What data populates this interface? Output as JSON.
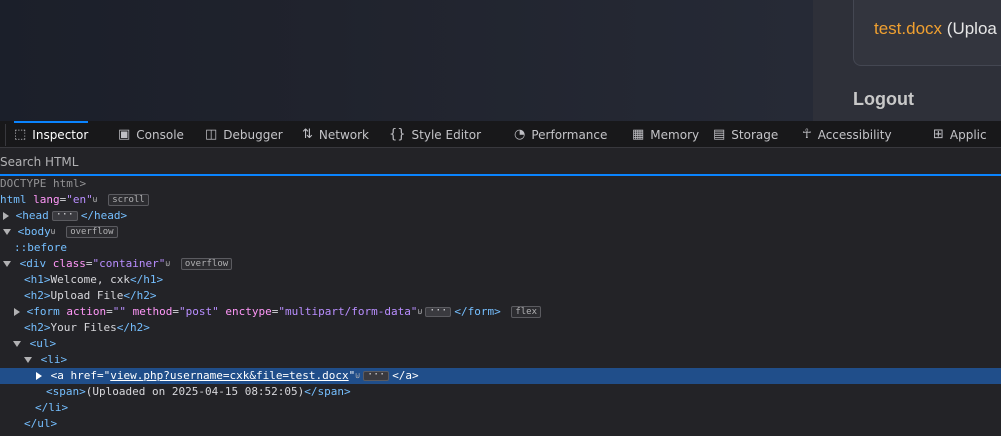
{
  "page": {
    "file_link": "test.docx",
    "file_meta": "(Uploa",
    "logout": "Logout"
  },
  "devtools": {
    "tabs": [
      {
        "label": "Inspector",
        "icon": "inspector-icon"
      },
      {
        "label": "Console",
        "icon": "console-icon"
      },
      {
        "label": "Debugger",
        "icon": "debugger-icon"
      },
      {
        "label": "Network",
        "icon": "network-icon"
      },
      {
        "label": "Style Editor",
        "icon": "style-editor-icon"
      },
      {
        "label": "Performance",
        "icon": "performance-icon"
      },
      {
        "label": "Memory",
        "icon": "memory-icon"
      },
      {
        "label": "Storage",
        "icon": "storage-icon"
      },
      {
        "label": "Accessibility",
        "icon": "accessibility-icon"
      },
      {
        "label": "Applic",
        "icon": "application-icon"
      }
    ],
    "active_tab": "Inspector",
    "search_placeholder": "Search HTML",
    "tree": {
      "doctype": "DOCTYPE html>",
      "html_tag": "html",
      "html_attr": "lang",
      "html_val": "\"en\"",
      "html_badge": "scroll",
      "head_open": "<head",
      "head_close": "</head>",
      "body_tag": "<body",
      "body_badge": "overflow",
      "before": "::before",
      "div_tag": "<div",
      "div_attr": "class",
      "div_val": "\"container\"",
      "div_badge": "overflow",
      "h1_open": "<h1>",
      "h1_text": "Welcome, cxk",
      "h1_close": "</h1>",
      "h2_open": "<h2>",
      "h2_text": "Upload File",
      "h2_close": "</h2>",
      "form_tag": "<form",
      "form_attr1": "action",
      "form_val1": "\"\"",
      "form_attr2": "method",
      "form_val2": "\"post\"",
      "form_attr3": "enctype",
      "form_val3": "\"multipart/form-data\"",
      "form_close": "</form>",
      "form_badge": "flex",
      "h2b_open": "<h2>",
      "h2b_text": "Your Files",
      "h2b_close": "</h2>",
      "ul_open": "<ul>",
      "li_open": "<li>",
      "a_tag": "<a",
      "a_attr": "href",
      "a_val": "view.php?username=cxk&file=test.docx",
      "a_close": "</a>",
      "span_open": "<span>",
      "span_text": "(Uploaded on 2025-04-15 08:52:05)",
      "span_close": "</span>",
      "li_close": "</li>",
      "ul_close": "</ul>"
    }
  }
}
